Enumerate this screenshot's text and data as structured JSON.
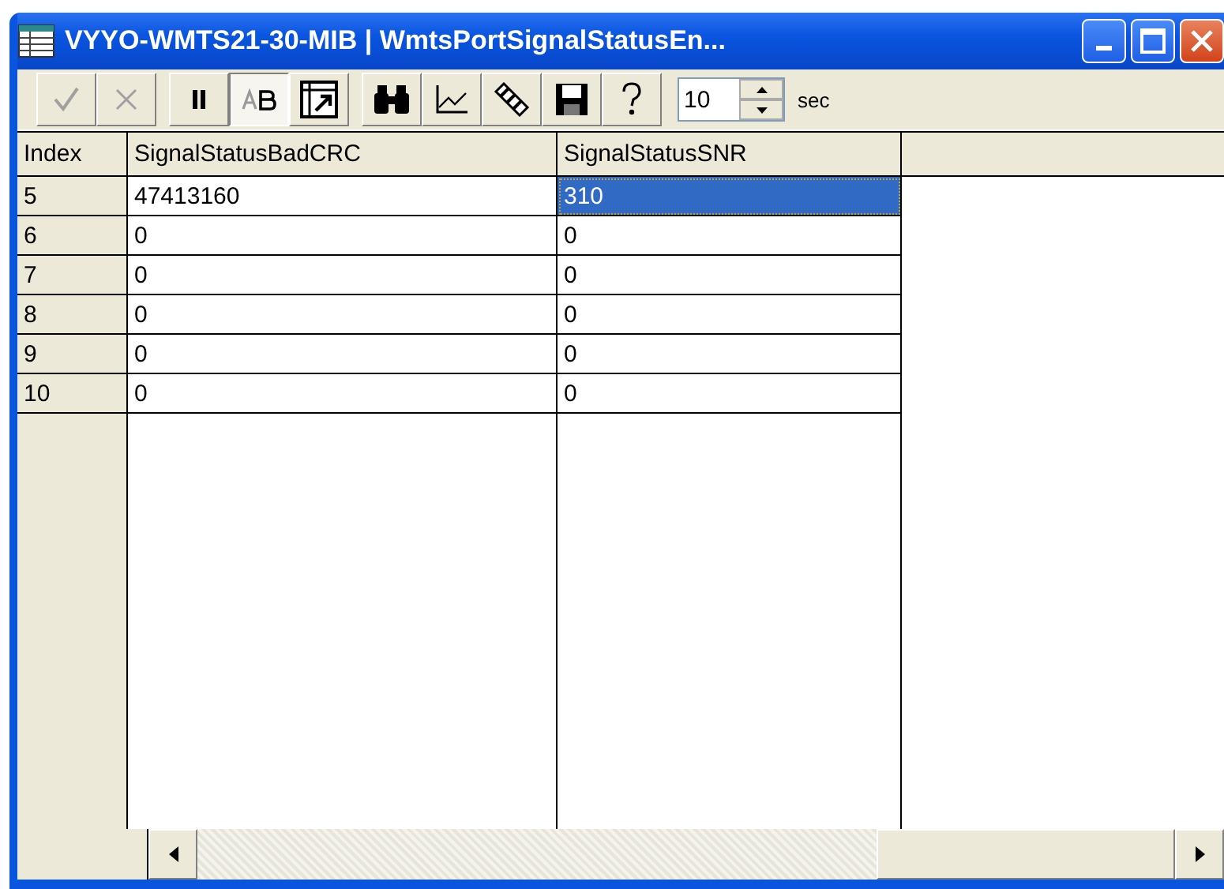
{
  "window": {
    "title": "VYYO-WMTS21-30-MIB | WmtsPortSignalStatusEn..."
  },
  "toolbar": {
    "buttons": [
      {
        "kind": "apply",
        "disabled": true,
        "pressed": false
      },
      {
        "kind": "cancel",
        "disabled": true,
        "pressed": false
      },
      {
        "kind": "pause",
        "disabled": false,
        "pressed": false
      },
      {
        "kind": "text",
        "disabled": false,
        "pressed": true
      },
      {
        "kind": "expand",
        "disabled": false,
        "pressed": false
      },
      {
        "kind": "find",
        "disabled": false,
        "pressed": false
      },
      {
        "kind": "graph",
        "disabled": false,
        "pressed": false
      },
      {
        "kind": "edit",
        "disabled": false,
        "pressed": false
      },
      {
        "kind": "save",
        "disabled": false,
        "pressed": false
      },
      {
        "kind": "help",
        "disabled": false,
        "pressed": false
      }
    ],
    "interval": {
      "value": "10",
      "unit": "sec"
    }
  },
  "table": {
    "columns": [
      "Index",
      "SignalStatusBadCRC",
      "SignalStatusSNR"
    ],
    "rows": [
      {
        "cells": [
          {
            "text": "5",
            "selected": false
          },
          {
            "text": "47413160",
            "selected": false
          },
          {
            "text": "310",
            "selected": true
          }
        ]
      },
      {
        "cells": [
          {
            "text": "6",
            "selected": false
          },
          {
            "text": "0",
            "selected": false
          },
          {
            "text": "0",
            "selected": false
          }
        ]
      },
      {
        "cells": [
          {
            "text": "7",
            "selected": false
          },
          {
            "text": "0",
            "selected": false
          },
          {
            "text": "0",
            "selected": false
          }
        ]
      },
      {
        "cells": [
          {
            "text": "8",
            "selected": false
          },
          {
            "text": "0",
            "selected": false
          },
          {
            "text": "0",
            "selected": false
          }
        ]
      },
      {
        "cells": [
          {
            "text": "9",
            "selected": false
          },
          {
            "text": "0",
            "selected": false
          },
          {
            "text": "0",
            "selected": false
          }
        ]
      },
      {
        "cells": [
          {
            "text": "10",
            "selected": false
          },
          {
            "text": "0",
            "selected": false
          },
          {
            "text": "0",
            "selected": false
          }
        ]
      }
    ]
  }
}
